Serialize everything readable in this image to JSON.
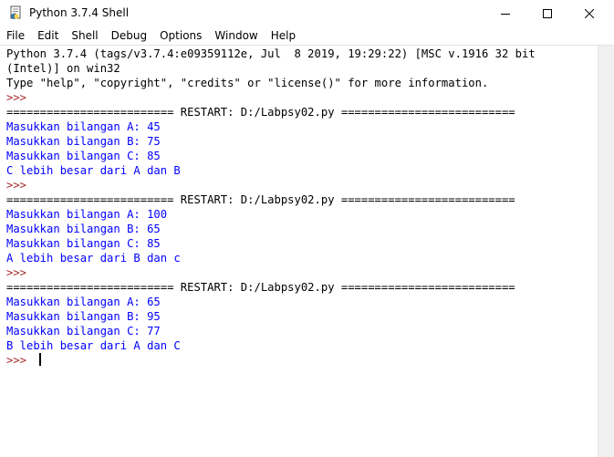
{
  "window": {
    "title": "Python 3.7.4 Shell",
    "icon": "python-idle-icon"
  },
  "menu": {
    "items": [
      "File",
      "Edit",
      "Shell",
      "Debug",
      "Options",
      "Window",
      "Help"
    ]
  },
  "shell": {
    "lines": [
      {
        "text": "Python 3.7.4 (tags/v3.7.4:e09359112e, Jul  8 2019, 19:29:22) [MSC v.1916 32 bit",
        "kind": "banner"
      },
      {
        "text": "(Intel)] on win32",
        "kind": "banner"
      },
      {
        "text": "Type \"help\", \"copyright\", \"credits\" or \"license()\" for more information.",
        "kind": "banner"
      },
      {
        "text": ">>> ",
        "kind": "prompt"
      },
      {
        "text": "========================= RESTART: D:/Labpsy02.py ==========================",
        "kind": "restart"
      },
      {
        "text": "Masukkan bilangan A: 45",
        "kind": "input"
      },
      {
        "text": "Masukkan bilangan B: 75",
        "kind": "input"
      },
      {
        "text": "Masukkan bilangan C: 85",
        "kind": "input"
      },
      {
        "text": "C lebih besar dari A dan B",
        "kind": "output"
      },
      {
        "text": ">>> ",
        "kind": "prompt"
      },
      {
        "text": "========================= RESTART: D:/Labpsy02.py ==========================",
        "kind": "restart"
      },
      {
        "text": "Masukkan bilangan A: 100",
        "kind": "input"
      },
      {
        "text": "Masukkan bilangan B: 65",
        "kind": "input"
      },
      {
        "text": "Masukkan bilangan C: 85",
        "kind": "input"
      },
      {
        "text": "A lebih besar dari B dan c",
        "kind": "output"
      },
      {
        "text": ">>> ",
        "kind": "prompt"
      },
      {
        "text": "========================= RESTART: D:/Labpsy02.py ==========================",
        "kind": "restart"
      },
      {
        "text": "Masukkan bilangan A: 65",
        "kind": "input"
      },
      {
        "text": "Masukkan bilangan B: 95",
        "kind": "input"
      },
      {
        "text": "Masukkan bilangan C: 77",
        "kind": "input"
      },
      {
        "text": "B lebih besar dari A dan C",
        "kind": "output"
      },
      {
        "text": ">>> ",
        "kind": "prompt-active"
      }
    ]
  },
  "colors": {
    "prompt": "#a52a2a",
    "stdout": "#0000ff",
    "banner": "#000000"
  }
}
